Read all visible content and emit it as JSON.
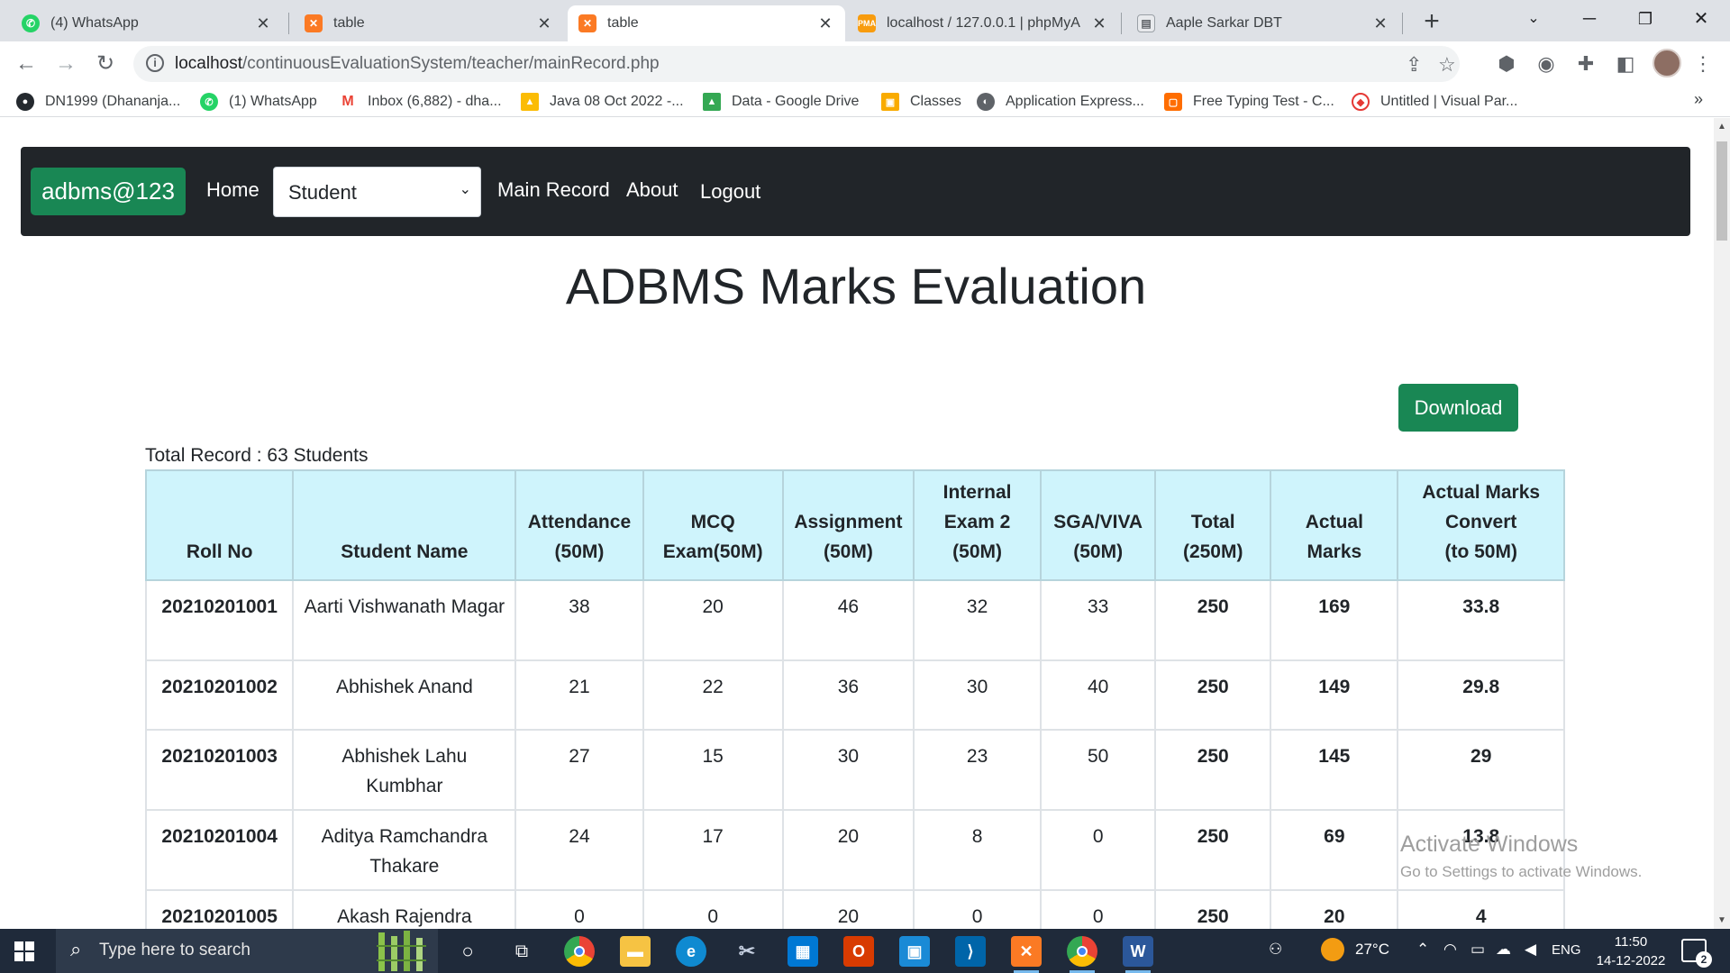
{
  "browser": {
    "tabs": [
      {
        "title": "(4) WhatsApp",
        "icon": "whatsapp-icon",
        "active": false
      },
      {
        "title": "table",
        "icon": "xampp-icon",
        "active": false
      },
      {
        "title": "table",
        "icon": "xampp-icon",
        "active": true
      },
      {
        "title": "localhost / 127.0.0.1 | phpMyA",
        "icon": "phpmyadmin-icon",
        "active": false
      },
      {
        "title": "Aaple Sarkar DBT",
        "icon": "document-icon",
        "active": false
      }
    ],
    "url_host": "localhost",
    "url_path": "/continuousEvaluationSystem/teacher/mainRecord.php",
    "bookmarks": [
      {
        "label": "DN1999 (Dhananja...",
        "icon": "github-icon",
        "color": "#24292e"
      },
      {
        "label": "(1) WhatsApp",
        "icon": "whatsapp-icon",
        "color": "#25d366"
      },
      {
        "label": "Inbox (6,882) - dha...",
        "icon": "gmail-icon",
        "color": "#ea4335"
      },
      {
        "label": "Java 08 Oct 2022 -...",
        "icon": "google-drive-icon",
        "color": "#fbbc04"
      },
      {
        "label": "Data - Google Drive",
        "icon": "google-drive-icon",
        "color": "#34a853"
      },
      {
        "label": "Classes",
        "icon": "classroom-icon",
        "color": "#f9ab00"
      },
      {
        "label": "Application Express...",
        "icon": "globe-icon",
        "color": "#5f6368"
      },
      {
        "label": "Free Typing Test - C...",
        "icon": "typing-icon",
        "color": "#ff6d00"
      },
      {
        "label": "Untitled | Visual Par...",
        "icon": "visual-paradigm-icon",
        "color": "#e53935"
      }
    ]
  },
  "site": {
    "brand": "adbms@123",
    "nav": {
      "home": "Home",
      "select_value": "Student",
      "main_record": "Main Record",
      "about": "About",
      "logout": "Logout"
    },
    "heading": "ADBMS Marks Evaluation",
    "download_label": "Download",
    "total_record": "Total Record : 63 Students"
  },
  "table": {
    "headers": [
      [
        "Roll No"
      ],
      [
        "Student Name"
      ],
      [
        "Attendance",
        "(50M)"
      ],
      [
        "MCQ",
        "Exam(50M)"
      ],
      [
        "Assignment",
        "(50M)"
      ],
      [
        "Internal",
        "Exam 2",
        "(50M)"
      ],
      [
        "SGA/VIVA",
        "(50M)"
      ],
      [
        "Total",
        "(250M)"
      ],
      [
        "Actual",
        "Marks"
      ],
      [
        "Actual Marks",
        "Convert",
        "(to 50M)"
      ]
    ],
    "rows": [
      {
        "roll": "20210201001",
        "name": "Aarti Vishwanath Magar",
        "attendance": "38",
        "mcq": "20",
        "assignment": "46",
        "internal": "32",
        "viva": "33",
        "total": "250",
        "actual": "169",
        "convert": "33.8"
      },
      {
        "roll": "20210201002",
        "name": "Abhishek Anand",
        "attendance": "21",
        "mcq": "22",
        "assignment": "36",
        "internal": "30",
        "viva": "40",
        "total": "250",
        "actual": "149",
        "convert": "29.8"
      },
      {
        "roll": "20210201003",
        "name": "Abhishek Lahu Kumbhar",
        "attendance": "27",
        "mcq": "15",
        "assignment": "30",
        "internal": "23",
        "viva": "50",
        "total": "250",
        "actual": "145",
        "convert": "29"
      },
      {
        "roll": "20210201004",
        "name": "Aditya Ramchandra Thakare",
        "attendance": "24",
        "mcq": "17",
        "assignment": "20",
        "internal": "8",
        "viva": "0",
        "total": "250",
        "actual": "69",
        "convert": "13.8"
      },
      {
        "roll": "20210201005",
        "name": "Akash Rajendra",
        "attendance": "0",
        "mcq": "0",
        "assignment": "20",
        "internal": "0",
        "viva": "0",
        "total": "250",
        "actual": "20",
        "convert": "4"
      }
    ]
  },
  "watermark": {
    "line1": "Activate Windows",
    "line2": "Go to Settings to activate Windows."
  },
  "taskbar": {
    "search_placeholder": "Type here to search",
    "weather": "27°C",
    "language": "ENG",
    "time": "11:50",
    "date": "14-12-2022",
    "notification_count": "2"
  }
}
